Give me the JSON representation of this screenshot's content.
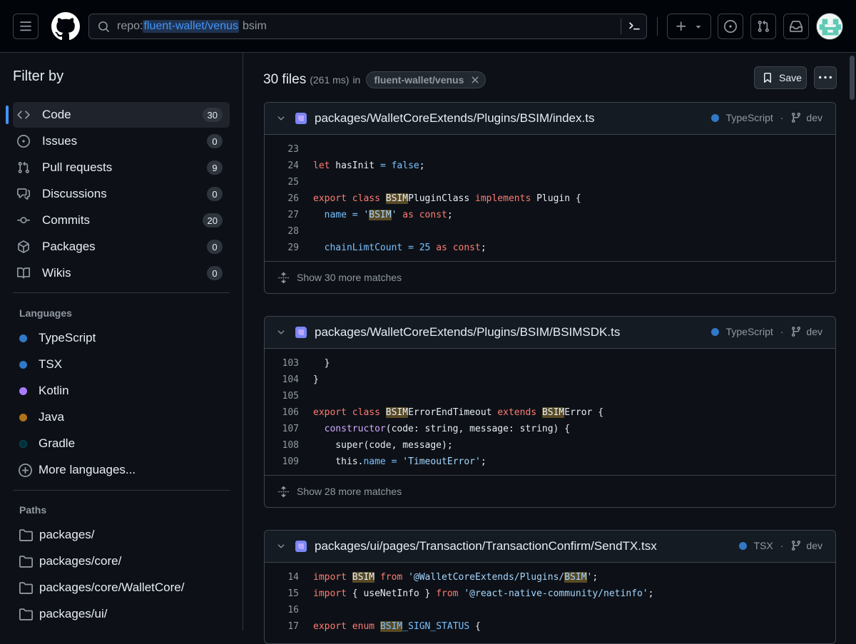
{
  "search": {
    "prefix": "repo:",
    "repo": "fluent-wallet/venus",
    "term": "bsim"
  },
  "sidebar": {
    "title": "Filter by",
    "types": [
      {
        "label": "Code",
        "count": "30"
      },
      {
        "label": "Issues",
        "count": "0"
      },
      {
        "label": "Pull requests",
        "count": "9"
      },
      {
        "label": "Discussions",
        "count": "0"
      },
      {
        "label": "Commits",
        "count": "20"
      },
      {
        "label": "Packages",
        "count": "0"
      },
      {
        "label": "Wikis",
        "count": "0"
      }
    ],
    "languages_title": "Languages",
    "languages": [
      {
        "label": "TypeScript",
        "color": "#3178c6"
      },
      {
        "label": "TSX",
        "color": "#3178c6"
      },
      {
        "label": "Kotlin",
        "color": "#a97bff"
      },
      {
        "label": "Java",
        "color": "#b07219"
      },
      {
        "label": "Gradle",
        "color": "#02303a"
      }
    ],
    "more_languages": "More languages...",
    "paths_title": "Paths",
    "paths": [
      "packages/",
      "packages/core/",
      "packages/core/WalletCore/",
      "packages/ui/"
    ]
  },
  "results": {
    "count": "30 files",
    "time": "(261 ms)",
    "in": "in",
    "repo_chip": "fluent-wallet/venus",
    "save_label": "Save"
  },
  "files": [
    {
      "path": "packages/WalletCoreExtends/Plugins/BSIM/index.ts",
      "language": "TypeScript",
      "branch": "dev",
      "more": "Show 30 more matches",
      "lines": [
        {
          "n": "23",
          "code": ""
        },
        {
          "n": "24",
          "code": "let hasInit = false;"
        },
        {
          "n": "25",
          "code": ""
        },
        {
          "n": "26",
          "code": "export class BSIMPluginClass implements Plugin {"
        },
        {
          "n": "27",
          "code": "  name = 'BSIM' as const;"
        },
        {
          "n": "28",
          "code": ""
        },
        {
          "n": "29",
          "code": "  chainLimtCount = 25 as const;"
        }
      ]
    },
    {
      "path": "packages/WalletCoreExtends/Plugins/BSIM/BSIMSDK.ts",
      "language": "TypeScript",
      "branch": "dev",
      "more": "Show 28 more matches",
      "lines": [
        {
          "n": "103",
          "code": "  }"
        },
        {
          "n": "104",
          "code": "}"
        },
        {
          "n": "105",
          "code": ""
        },
        {
          "n": "106",
          "code": "export class BSIMErrorEndTimeout extends BSIMError {"
        },
        {
          "n": "107",
          "code": "  constructor(code: string, message: string) {"
        },
        {
          "n": "108",
          "code": "    super(code, message);"
        },
        {
          "n": "109",
          "code": "    this.name = 'TimeoutError';"
        }
      ]
    },
    {
      "path": "packages/ui/pages/Transaction/TransactionConfirm/SendTX.tsx",
      "language": "TSX",
      "branch": "dev",
      "more": "",
      "lines": [
        {
          "n": "14",
          "code": "import BSIM from '@WalletCoreExtends/Plugins/BSIM';"
        },
        {
          "n": "15",
          "code": "import { useNetInfo } from '@react-native-community/netinfo';"
        },
        {
          "n": "16",
          "code": ""
        },
        {
          "n": "17",
          "code": "export enum BSIM_SIGN_STATUS {"
        }
      ]
    }
  ]
}
